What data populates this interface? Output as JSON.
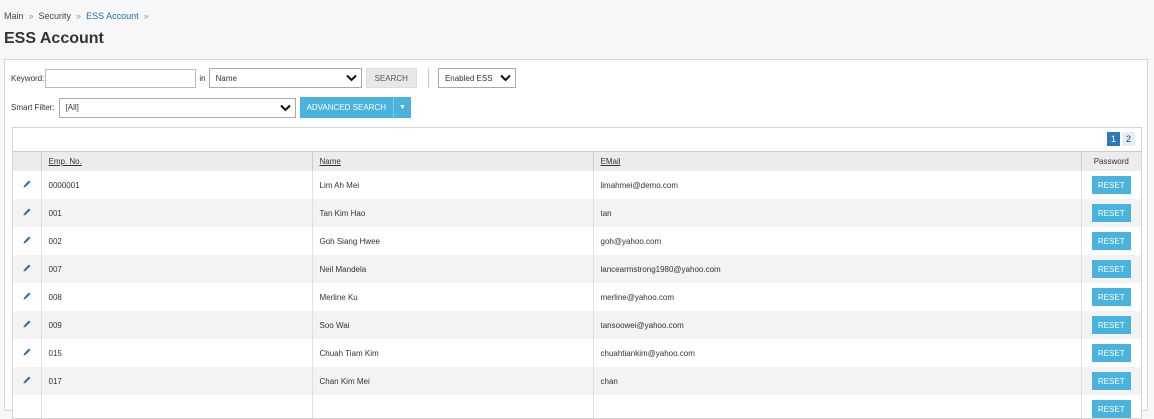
{
  "breadcrumb": [
    {
      "label": "Main"
    },
    {
      "label": "Security"
    },
    {
      "label": "ESS Account"
    }
  ],
  "breadcrumb_separator": "»",
  "page_title": "ESS Account",
  "filters": {
    "keyword_label": "Keyword:",
    "keyword_value": "",
    "in_label": "in",
    "field_select_value": "Name",
    "search_label": "SEARCH",
    "status_select_value": "Enabled ESS",
    "smart_filter_label": "Smart Filter:",
    "smart_filter_value": "[All]",
    "advanced_search_label": "ADVANCED SEARCH"
  },
  "pager": {
    "pages": [
      "1",
      "2"
    ],
    "current": "1"
  },
  "table": {
    "columns": {
      "emp_no": "Emp. No.",
      "name": "Name",
      "email": "EMail",
      "password": "Password"
    },
    "reset_label": "RESET",
    "rows": [
      {
        "emp_no": "0000001",
        "name": "Lim Ah Mei",
        "email": "limahmei@demo.com"
      },
      {
        "emp_no": "001",
        "name": "Tan Kim Hao",
        "email": "tan"
      },
      {
        "emp_no": "002",
        "name": "Goh Siang Hwee",
        "email": "goh@yahoo.com"
      },
      {
        "emp_no": "007",
        "name": "Neil Mandela",
        "email": "lancearmstrong1980@yahoo.com"
      },
      {
        "emp_no": "008",
        "name": "Merline Ku",
        "email": "merline@yahoo.com"
      },
      {
        "emp_no": "009",
        "name": "Soo Wai",
        "email": "tansoowei@yahoo.com"
      },
      {
        "emp_no": "015",
        "name": "Chuah Tiam Kim",
        "email": "chuahtiankim@yahoo.com"
      },
      {
        "emp_no": "017",
        "name": "Chan Kim Mei",
        "email": "chan"
      },
      {
        "emp_no": "",
        "name": "",
        "email": ""
      }
    ]
  },
  "colors": {
    "accent": "#4ab3dd",
    "link": "#1a6fb5",
    "pager_active": "#2d7ab9"
  },
  "icons": {
    "edit": "pencil-icon",
    "dropdown": "chevron-down-icon"
  }
}
